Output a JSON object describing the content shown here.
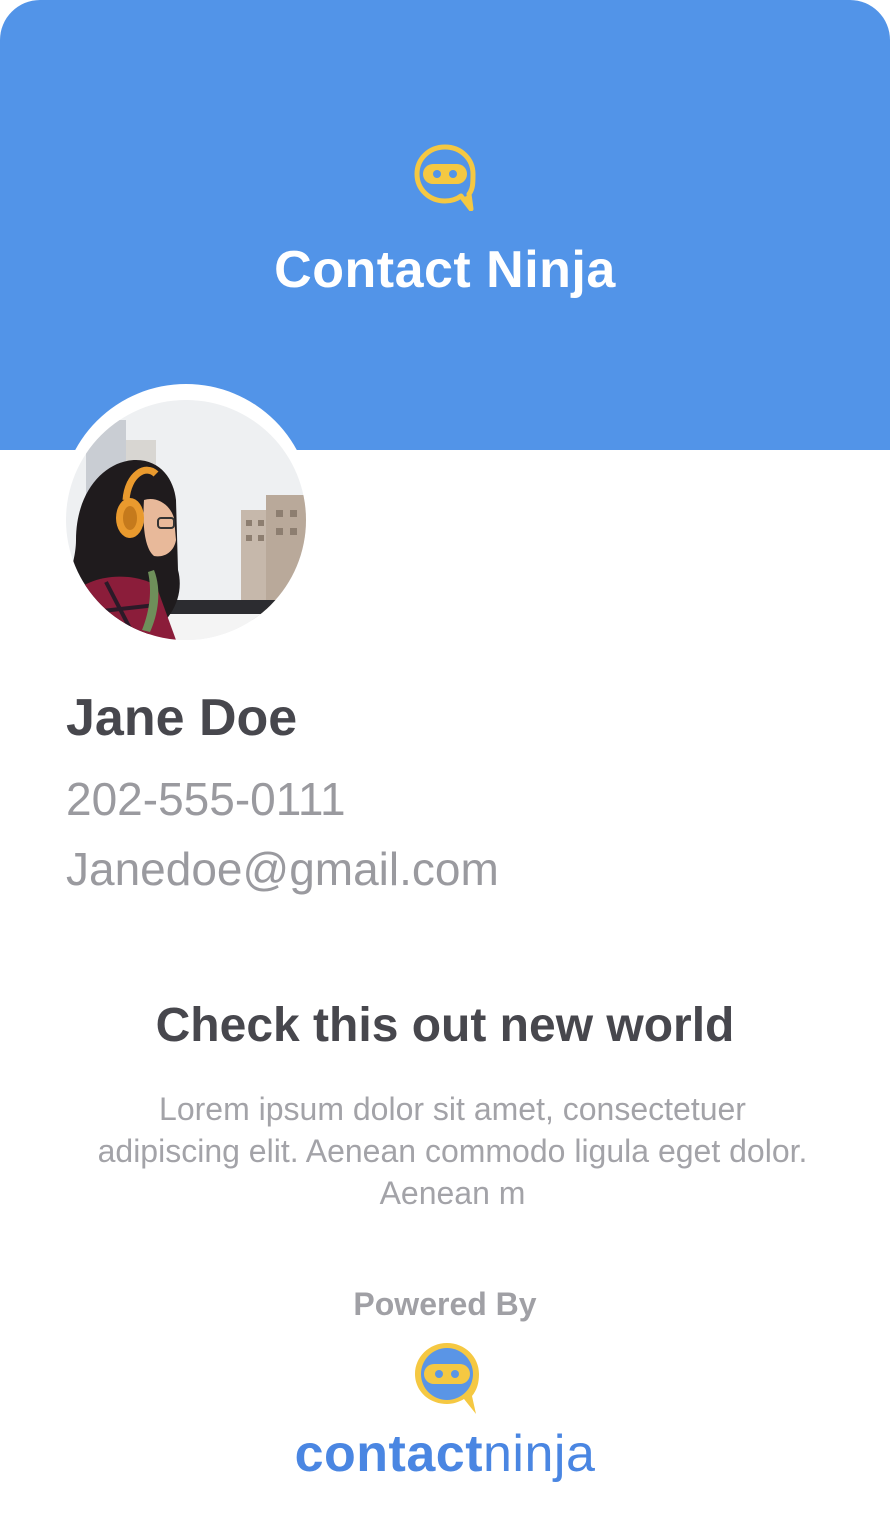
{
  "header": {
    "title": "Contact Ninja",
    "logo_icon": "ninja-chat-icon"
  },
  "profile": {
    "avatar_icon": "profile-photo",
    "name": "Jane Doe",
    "phone": "202-555-0111",
    "email": "Janedoe@gmail.com"
  },
  "content": {
    "headline": "Check this out new world",
    "body": "Lorem ipsum dolor sit amet, consectetuer adipiscing elit. Aenean commodo ligula eget dolor. Aenean m"
  },
  "footer": {
    "powered_by": "Powered By",
    "logo_icon": "ninja-chat-icon",
    "brand_bold": "contact",
    "brand_light": "ninja"
  },
  "colors": {
    "header_bg": "#5294e8",
    "brand_blue": "#4a86e2",
    "logo_yellow": "#f5c842",
    "text_dark": "#47474d",
    "text_muted": "#9a9a9f"
  }
}
